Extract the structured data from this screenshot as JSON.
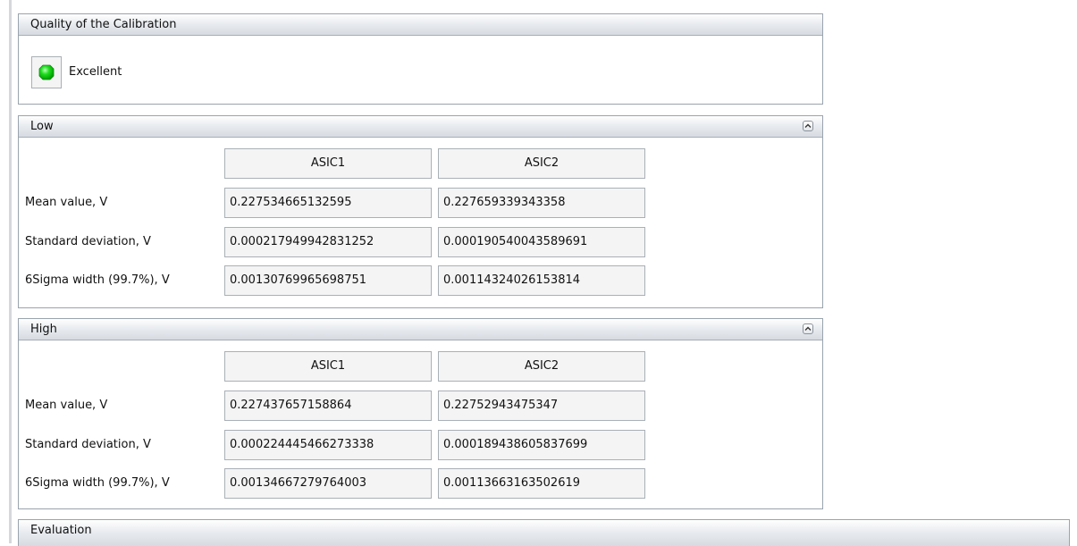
{
  "quality": {
    "title": "Quality of the Calibration",
    "status_label": "Excellent",
    "status_color": "#00cc00"
  },
  "low": {
    "title": "Low",
    "columns": [
      "ASIC1",
      "ASIC2"
    ],
    "rows": [
      {
        "label": "Mean value, V",
        "values": [
          "0.227534665132595",
          "0.227659339343358"
        ]
      },
      {
        "label": "Standard deviation, V",
        "values": [
          "0.000217949942831252",
          "0.000190540043589691"
        ]
      },
      {
        "label": "6Sigma width (99.7%), V",
        "values": [
          "0.00130769965698751",
          "0.00114324026153814"
        ]
      }
    ]
  },
  "high": {
    "title": "High",
    "columns": [
      "ASIC1",
      "ASIC2"
    ],
    "rows": [
      {
        "label": "Mean value, V",
        "values": [
          "0.227437657158864",
          "0.22752943475347"
        ]
      },
      {
        "label": "Standard deviation, V",
        "values": [
          "0.000224445466273338",
          "0.000189438605837699"
        ]
      },
      {
        "label": "6Sigma width (99.7%), V",
        "values": [
          "0.00134667279764003",
          "0.00113663163502619"
        ]
      }
    ]
  },
  "evaluation": {
    "title": "Evaluation"
  }
}
